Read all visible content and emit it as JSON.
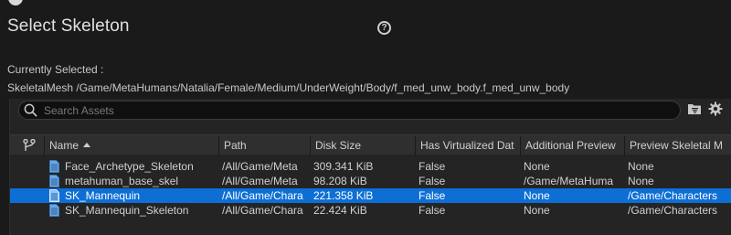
{
  "dialog": {
    "title": "Select Skeleton",
    "currently_selected_label": "Currently Selected :",
    "currently_selected_value": "SkeletalMesh /Game/MetaHumans/Natalia/Female/Medium/UnderWeight/Body/f_med_unw_body.f_med_unw_body"
  },
  "search": {
    "placeholder": "Search Assets",
    "value": ""
  },
  "table": {
    "columns": [
      "Name",
      "Path",
      "Disk Size",
      "Has Virtualized Dat",
      "Additional Preview",
      "Preview Skeletal M"
    ],
    "sort_column": "Name",
    "sort_direction": "ascending",
    "rows": [
      {
        "name": "Face_Archetype_Skeleton",
        "path": "/All/Game/Meta",
        "disk_size": "309.341 KiB",
        "virtualized": "False",
        "additional_preview": "None",
        "preview_mesh": "None",
        "selected": false
      },
      {
        "name": "metahuman_base_skel",
        "path": "/All/Game/Meta",
        "disk_size": "98.208 KiB",
        "virtualized": "False",
        "additional_preview": "/Game/MetaHuma",
        "preview_mesh": "None",
        "selected": false
      },
      {
        "name": "SK_Mannequin",
        "path": "/All/Game/Chara",
        "disk_size": "221.358 KiB",
        "virtualized": "False",
        "additional_preview": "None",
        "preview_mesh": "/Game/Characters",
        "selected": true
      },
      {
        "name": "SK_Mannequin_Skeleton",
        "path": "/All/Game/Chara",
        "disk_size": "22.424 KiB",
        "virtualized": "False",
        "additional_preview": "None",
        "preview_mesh": "/Game/Characters",
        "selected": false
      }
    ]
  },
  "icons": {
    "top": "engine-logo-icon",
    "help": "help-icon",
    "search": "search-icon",
    "folder": "folder-filter-icon",
    "settings": "gear-icon",
    "branch": "branch-icon",
    "asset": "skeleton-asset-icon"
  },
  "colors": {
    "background": "#1a1a1a",
    "selection": "#0d6fd6",
    "header": "#2f2f2f"
  }
}
